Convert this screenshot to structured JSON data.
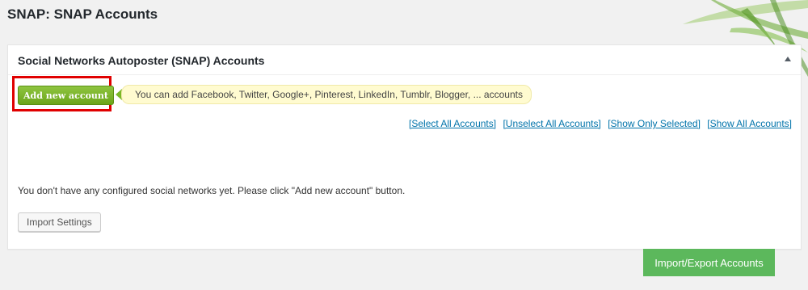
{
  "page": {
    "title": "SNAP: SNAP Accounts"
  },
  "panel": {
    "title": "Social Networks Autoposter (SNAP) Accounts"
  },
  "add_account": {
    "label": "Add new account",
    "hint": "You can add Facebook, Twitter, Google+, Pinterest, LinkedIn, Tumblr, Blogger, ... accounts"
  },
  "selection_links": [
    "[Select All Accounts]",
    "[Unselect All Accounts]",
    "[Show Only Selected]",
    "[Show All Accounts]"
  ],
  "empty_message": "You don't have any configured social networks yet. Please click \"Add new account\" button.",
  "import_settings_label": "Import Settings",
  "import_export_label": "Import/Export Accounts",
  "colors": {
    "highlight": "#e00000",
    "add_button": "#6ba51a",
    "link": "#0073aa",
    "export_button": "#5cb85c",
    "hint_bg": "#fffbd0"
  }
}
